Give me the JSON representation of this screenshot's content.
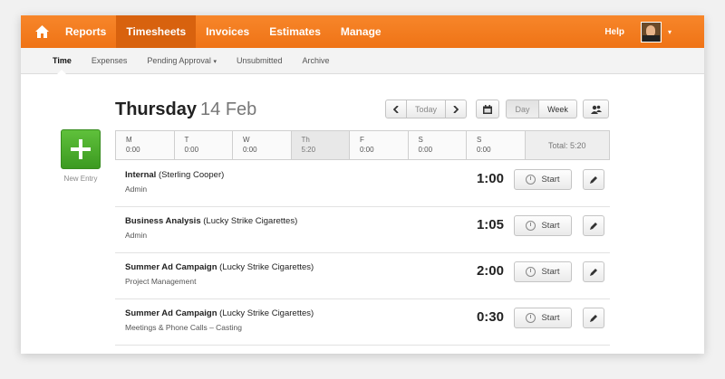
{
  "nav": {
    "items": [
      "Reports",
      "Timesheets",
      "Invoices",
      "Estimates",
      "Manage"
    ],
    "active": "Timesheets",
    "help_label": "Help",
    "accent_color": "#f47b20"
  },
  "subnav": {
    "items": [
      "Time",
      "Expenses",
      "Pending Approval",
      "Unsubmitted",
      "Archive"
    ],
    "pending_caret": "▾"
  },
  "date": {
    "day": "Thursday",
    "date": "14 Feb"
  },
  "controls": {
    "today_label": "Today",
    "day_label": "Day",
    "week_label": "Week"
  },
  "new_entry": {
    "label": "New Entry"
  },
  "week": {
    "days": [
      {
        "letter": "M",
        "time": "0:00"
      },
      {
        "letter": "T",
        "time": "0:00"
      },
      {
        "letter": "W",
        "time": "0:00"
      },
      {
        "letter": "Th",
        "time": "5:20"
      },
      {
        "letter": "F",
        "time": "0:00"
      },
      {
        "letter": "S",
        "time": "0:00"
      },
      {
        "letter": "S",
        "time": "0:00"
      }
    ],
    "total": "Total: 5:20"
  },
  "entries": [
    {
      "project": "Internal",
      "client": "(Sterling Cooper)",
      "task": "Admin",
      "time": "1:00",
      "start_label": "Start"
    },
    {
      "project": "Business Analysis",
      "client": "(Lucky Strike Cigarettes)",
      "task": "Admin",
      "time": "1:05",
      "start_label": "Start"
    },
    {
      "project": "Summer Ad Campaign",
      "client": "(Lucky Strike Cigarettes)",
      "task": "Project Management",
      "time": "2:00",
      "start_label": "Start"
    },
    {
      "project": "Summer Ad Campaign",
      "client": "(Lucky Strike Cigarettes)",
      "task": "Meetings & Phone Calls  –  Casting",
      "time": "0:30",
      "start_label": "Start"
    }
  ]
}
